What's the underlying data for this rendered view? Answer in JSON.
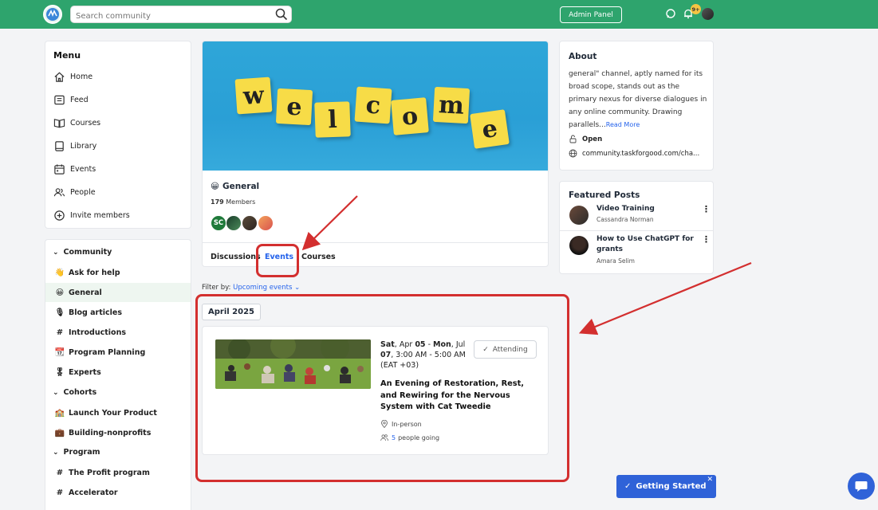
{
  "topbar": {
    "logo_text": "",
    "search_placeholder": "Search community",
    "admin_label": "Admin Panel",
    "notif_badge": "9+"
  },
  "menu": {
    "title": "Menu",
    "items": [
      {
        "label": "Home",
        "icon": "home-icon"
      },
      {
        "label": "Feed",
        "icon": "feed-icon"
      },
      {
        "label": "Courses",
        "icon": "book-open-icon"
      },
      {
        "label": "Library",
        "icon": "library-icon"
      },
      {
        "label": "Events",
        "icon": "calendar-icon"
      },
      {
        "label": "People",
        "icon": "people-icon"
      },
      {
        "label": "Invite members",
        "icon": "plus-circle-icon"
      }
    ]
  },
  "sidebar": {
    "sections": [
      {
        "title": "Community",
        "items": [
          {
            "emoji": "👋",
            "label": "Ask for help"
          },
          {
            "emoji": "😀",
            "label": "General",
            "active": true
          },
          {
            "emoji": "🎙",
            "label": "Blog articles"
          },
          {
            "emoji": "#",
            "label": "Introductions"
          },
          {
            "emoji": "📆",
            "label": "Program Planning"
          },
          {
            "emoji": "🎖",
            "label": "Experts"
          }
        ]
      },
      {
        "title": "Cohorts",
        "items": [
          {
            "emoji": "🏫",
            "label": "Launch Your Product"
          },
          {
            "emoji": "💼",
            "label": "Building-nonprofits"
          }
        ]
      },
      {
        "title": "Program",
        "items": [
          {
            "emoji": "#",
            "label": "The Profit program"
          },
          {
            "emoji": "#",
            "label": "Accelerator"
          }
        ]
      }
    ]
  },
  "group": {
    "banner_letters": [
      "w",
      "e",
      "l",
      "c",
      "o",
      "m",
      "e"
    ],
    "emoji": "😀",
    "name": "General",
    "members_count": "179",
    "members_label": "Members",
    "avatar_initials": "SC",
    "tabs": [
      "Discussions",
      "Events",
      "Courses"
    ],
    "active_tab": "Events"
  },
  "filter": {
    "label": "Filter by:",
    "value": "Upcoming events"
  },
  "events": {
    "month": "April 2025",
    "items": [
      {
        "date_start_day": "Sat",
        "date_start": "Apr",
        "date_start_num": "05",
        "date_end_day": "Mon",
        "date_end": "Jul",
        "date_end_num": "07",
        "time": "3:00 AM - 5:00 AM",
        "timezone": "(EAT +03)",
        "attend_label": "Attending",
        "title": "An Evening of Restoration, Rest, and Rewiring for the Nervous System with Cat Tweedie",
        "location": "In-person",
        "going_count": "5",
        "going_label": "people going"
      }
    ]
  },
  "about": {
    "title": "About",
    "text": "general\" channel, aptly named for its broad scope, stands out as the primary nexus for diverse dialogues in any online community. Drawing parallels...",
    "read_more": "Read More",
    "privacy": "Open",
    "url": "community.taskforgood.com/cha..."
  },
  "featured": {
    "title": "Featured Posts",
    "posts": [
      {
        "title": "Video Training",
        "author": "Cassandra Norman"
      },
      {
        "title": "How to Use ChatGPT for grants",
        "author": "Amara Selim"
      }
    ]
  },
  "getting_started": {
    "label": "Getting Started"
  },
  "colors": {
    "brand_green": "#2ea46d",
    "accent_blue": "#2563eb",
    "annotation_red": "#d32f2f"
  }
}
